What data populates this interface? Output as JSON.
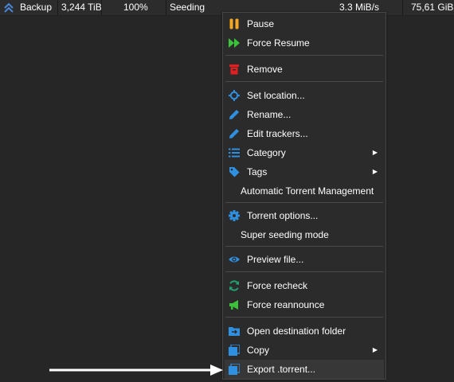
{
  "torrent_row": {
    "name": "Backup",
    "size": "3,244 TiB",
    "progress": "100%",
    "status": "Seeding",
    "upload_speed": "3.3 MiB/s",
    "uploaded": "75,61 GiB",
    "queue_icon": "double-chevron-up-icon"
  },
  "menu": {
    "pause": "Pause",
    "force_resume": "Force Resume",
    "remove": "Remove",
    "set_location": "Set location...",
    "rename": "Rename...",
    "edit_trackers": "Edit trackers...",
    "category": "Category",
    "tags": "Tags",
    "auto_tmm": "Automatic Torrent Management",
    "torrent_options": "Torrent options...",
    "super_seeding": "Super seeding mode",
    "preview_file": "Preview file...",
    "force_recheck": "Force recheck",
    "force_reannounce": "Force reannounce",
    "open_destination": "Open destination folder",
    "copy": "Copy",
    "export_torrent": "Export .torrent..."
  },
  "colors": {
    "pause_icon": "#f5a623",
    "resume_icon": "#3cc33c",
    "remove_icon": "#e02020",
    "blue_icon": "#2f8fe0",
    "recheck_icon": "#22a070",
    "reannounce_icon": "#3cc33c",
    "arrow": "#ffffff"
  }
}
